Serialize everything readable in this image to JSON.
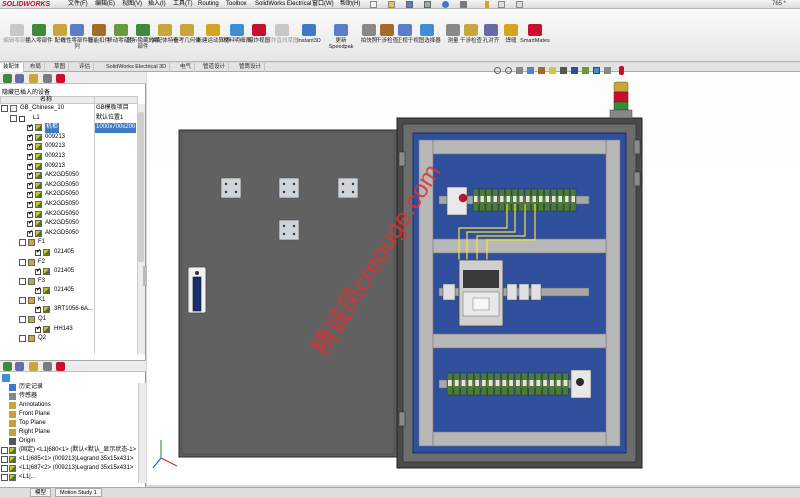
{
  "titlebar": {
    "logo": "SOLIDWORKS",
    "menus": [
      "文件(F)",
      "编辑(E)",
      "视图(V)",
      "插入(I)",
      "工具(T)",
      "Routing",
      "Toolbox",
      "SolidWorks Electrical",
      "窗口(W)",
      "帮助(H)"
    ],
    "doc_title": "765 *"
  },
  "ribbon": {
    "buttons": [
      {
        "label": "编辑零部件",
        "enabled": false
      },
      {
        "label": "插入零部件",
        "enabled": true
      },
      {
        "label": "配合",
        "enabled": true
      },
      {
        "label": "线性零部件阵列",
        "enabled": true
      },
      {
        "label": "智能扣件",
        "enabled": true
      },
      {
        "label": "移动零部件",
        "enabled": true
      },
      {
        "label": "显示隐藏的零部件",
        "enabled": true
      },
      {
        "label": "装配体特征",
        "enabled": true
      },
      {
        "label": "参考几何体",
        "enabled": true
      },
      {
        "label": "新建运动算例",
        "enabled": true
      },
      {
        "label": "材料明细表",
        "enabled": true
      },
      {
        "label": "爆炸视图",
        "enabled": true
      },
      {
        "label": "爆炸直线草图",
        "enabled": false
      },
      {
        "label": "Instant3D",
        "enabled": true
      },
      {
        "label": "更新Speedpak",
        "enabled": true
      },
      {
        "label": "拍快照",
        "enabled": true
      },
      {
        "label": "干涉检查",
        "enabled": true
      },
      {
        "label": "正视于",
        "enabled": true
      },
      {
        "label": "视图选择器",
        "enabled": true
      },
      {
        "label": "测量",
        "enabled": true
      },
      {
        "label": "干涉检查",
        "enabled": true
      },
      {
        "label": "孔对齐",
        "enabled": true
      },
      {
        "label": "焊缝",
        "enabled": true
      },
      {
        "label": "SmartMates",
        "enabled": true
      }
    ]
  },
  "tabs": [
    "装配体",
    "布局",
    "草图",
    "评估",
    "SolidWorks Electrical 3D",
    "电气",
    "管道设计",
    "管筒设计"
  ],
  "feature_tree": {
    "hidden_label": "隐藏已插入的设备",
    "col_name": "名称",
    "root_name": "GB_Chinese_10",
    "root_desc": "GB模板项目",
    "location": "L1",
    "location_desc": "默认位置1",
    "items": [
      {
        "name": "机柜",
        "desc": "1000x700x200",
        "selected": true
      },
      {
        "name": "009213",
        "desc": ""
      },
      {
        "name": "009213",
        "desc": ""
      },
      {
        "name": "009213",
        "desc": ""
      },
      {
        "name": "009213",
        "desc": ""
      },
      {
        "name": "AK2GD5050",
        "desc": ""
      },
      {
        "name": "AK2GD5050",
        "desc": ""
      },
      {
        "name": "AK2GD5050",
        "desc": ""
      },
      {
        "name": "AK2GD5050",
        "desc": ""
      },
      {
        "name": "AK2GD5050",
        "desc": ""
      },
      {
        "name": "AK2GD5050",
        "desc": ""
      },
      {
        "name": "AK2GD5050",
        "desc": ""
      }
    ],
    "groups": [
      {
        "name": "F1",
        "child": "021405"
      },
      {
        "name": "F2",
        "child": "021405"
      },
      {
        "name": "F3",
        "child": "021405"
      },
      {
        "name": "K1",
        "child": "3RT1056-6A..."
      },
      {
        "name": "Q1",
        "child": "HH143"
      },
      {
        "name": "Q2",
        "child": ""
      }
    ]
  },
  "design_tree": {
    "items": [
      "历史记录",
      "传感器",
      "Annotations",
      "Front Plane",
      "Top Plane",
      "Right Plane",
      "Origin"
    ],
    "parts": [
      "(固定) <L1|680<1> (默认<默认_显示状态-1>",
      "<L1|685<1> (009213)Legrand 35x15x431>",
      "<L1|687<2> (009213)Legrand 35x15x431>",
      "<L1|..."
    ]
  },
  "bottom_tabs": [
    "模型",
    "Motion Study 1"
  ],
  "watermark": "精诚凤creouge.com",
  "colors": {
    "panel_blue": "#2f4f9c",
    "rail_gray": "#b7b7b7",
    "door_gray": "#5a5a5a",
    "watermark": "#e03030"
  }
}
